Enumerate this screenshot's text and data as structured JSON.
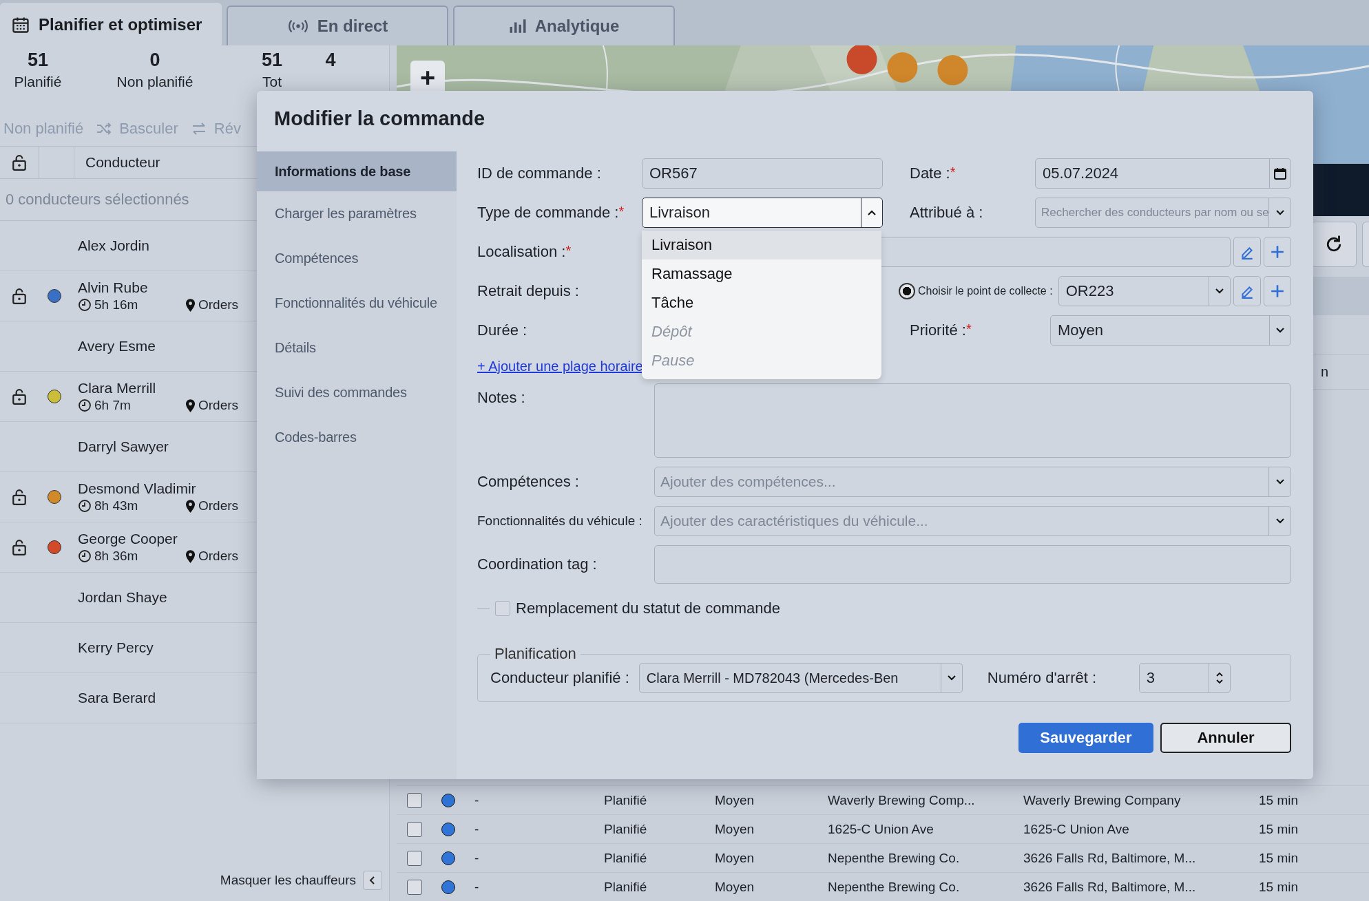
{
  "tabs": [
    {
      "label": "Planifier et optimiser",
      "selected": true
    },
    {
      "label": "En direct",
      "selected": false
    },
    {
      "label": "Analytique",
      "selected": false
    }
  ],
  "stats": [
    {
      "value": "51",
      "label": "Planifié"
    },
    {
      "value": "0",
      "label": "Non planifié"
    },
    {
      "value": "51",
      "label": "Tot"
    },
    {
      "value": "4"
    }
  ],
  "toolbar": [
    "Non planifié",
    "Basculer",
    "Rév"
  ],
  "drivers": {
    "header": "Conducteur",
    "selection_note": "0 conducteurs sélectionnés",
    "items": [
      {
        "name": "Alex Jordin"
      },
      {
        "name": "Alvin Rube",
        "color": "#3b6fc4",
        "duration": "5h 16m",
        "orders": "Orders"
      },
      {
        "name": "Avery Esme"
      },
      {
        "name": "Clara Merrill",
        "color": "#c9bd3a",
        "duration": "6h 7m",
        "orders": "Orders"
      },
      {
        "name": "Darryl Sawyer"
      },
      {
        "name": "Desmond Vladimir",
        "color": "#d08a2a",
        "duration": "8h 43m",
        "orders": "Orders"
      },
      {
        "name": "George Cooper",
        "color": "#d24a2a",
        "duration": "8h 36m",
        "orders": "Orders"
      },
      {
        "name": "Jordan Shaye"
      },
      {
        "name": "Kerry Percy"
      },
      {
        "name": "Sara Berard"
      }
    ],
    "hide_label": "Masquer les chauffeurs"
  },
  "map": {
    "zoom_in": "+"
  },
  "orders_table": {
    "column_fragment": "n",
    "rows": [
      {
        "checked": false,
        "color": "#2f74d6",
        "reference": "-",
        "status": "Planifié",
        "priority": "Moyen",
        "name": "Waverly Brewing Comp...",
        "address": "Waverly Brewing Company",
        "duration": "15 min"
      },
      {
        "checked": false,
        "color": "#2f74d6",
        "reference": "-",
        "status": "Planifié",
        "priority": "Moyen",
        "name": "1625-C Union Ave",
        "address": "1625-C Union Ave",
        "duration": "15 min"
      },
      {
        "checked": false,
        "color": "#2f74d6",
        "reference": "-",
        "status": "Planifié",
        "priority": "Moyen",
        "name": "Nepenthe Brewing Co.",
        "address": "3626 Falls Rd, Baltimore, M...",
        "duration": "15 min"
      },
      {
        "checked": false,
        "color": "#2f74d6",
        "reference": "-",
        "status": "Planifié",
        "priority": "Moyen",
        "name": "Nepenthe Brewing Co.",
        "address": "3626 Falls Rd, Baltimore, M...",
        "duration": "15 min"
      }
    ]
  },
  "dialog": {
    "title": "Modifier la commande",
    "nav": [
      {
        "label": "Informations de base",
        "selected": true
      },
      {
        "label": "Charger les paramètres",
        "selected": false
      },
      {
        "label": "Compétences",
        "selected": false
      },
      {
        "label": "Fonctionnalités du véhicule",
        "selected": false
      },
      {
        "label": "Détails",
        "selected": false
      },
      {
        "label": "Suivi des commandes",
        "selected": false
      },
      {
        "label": "Codes-barres",
        "selected": false
      }
    ],
    "order_id": {
      "label": "ID de commande :",
      "value": "OR567"
    },
    "date": {
      "label": "Date :",
      "required": "*",
      "value": "05.07.2024"
    },
    "order_type": {
      "label": "Type de commande :",
      "required": "*",
      "value": "Livraison",
      "expanded": true,
      "options": [
        {
          "label": "Livraison",
          "selected": true,
          "disabled": false
        },
        {
          "label": "Ramassage",
          "selected": false,
          "disabled": false
        },
        {
          "label": "Tâche",
          "selected": false,
          "disabled": false
        },
        {
          "label": "Dépôt",
          "selected": false,
          "disabled": true
        },
        {
          "label": "Pause",
          "selected": false,
          "disabled": true
        }
      ]
    },
    "assigned_to": {
      "label": "Attribué à :",
      "placeholder": "Rechercher des conducteurs par nom ou se"
    },
    "location": {
      "label": "Localisation :",
      "required": "*"
    },
    "pickup_from": {
      "label": "Retrait depuis :"
    },
    "pickup_point": {
      "label": "Choisir le point de collecte :",
      "selected": true,
      "value": "OR223"
    },
    "duration": {
      "label": "Durée :"
    },
    "priority": {
      "label": "Priorité :",
      "required": "*",
      "value": "Moyen"
    },
    "add_time_window": "+ Ajouter une plage horaire",
    "notes": {
      "label": "Notes :"
    },
    "skills": {
      "label": "Compétences :",
      "placeholder": "Ajouter des compétences..."
    },
    "vehicle_features": {
      "label": "Fonctionnalités du véhicule :",
      "placeholder": "Ajouter des caractéristiques du véhicule..."
    },
    "coordination_tag": {
      "label": "Coordination tag :"
    },
    "status_override": {
      "label": "Remplacement du statut de commande",
      "checked": false
    },
    "planning": {
      "legend": "Planification",
      "driver_label": "Conducteur planifié :",
      "driver_value": "Clara Merrill - MD782043 (Mercedes-Ben",
      "stop_label": "Numéro d'arrêt :",
      "stop_value": "3"
    },
    "buttons": [
      {
        "label": "Sauvegarder",
        "kind": "primary"
      },
      {
        "label": "Annuler",
        "kind": "secondary"
      }
    ]
  }
}
